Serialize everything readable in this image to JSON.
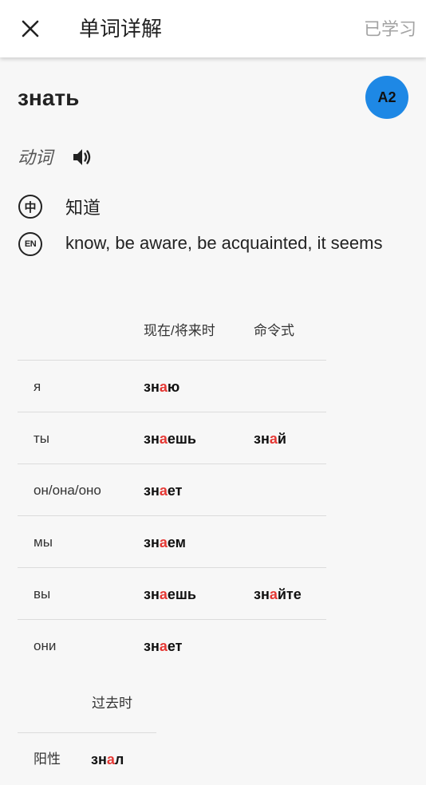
{
  "appbar": {
    "title": "单词详解",
    "learned_label": "已学习"
  },
  "word": {
    "text": "знать",
    "level": "A2",
    "part_of_speech": "动词",
    "meanings": {
      "zh_icon": "中",
      "zh": "知道",
      "en_icon": "EN",
      "en": "know, be aware, be acquainted, it seems"
    }
  },
  "conjugation": {
    "headers": {
      "present": "现在/将来时",
      "imperative": "命令式"
    },
    "rows": [
      {
        "pronoun": "я",
        "present": {
          "pre": "зн",
          "hl": "а",
          "post": "ю"
        },
        "imperative": null
      },
      {
        "pronoun": "ты",
        "present": {
          "pre": "зн",
          "hl": "а",
          "post": "ешь"
        },
        "imperative": {
          "pre": "зн",
          "hl": "а",
          "post": "й"
        }
      },
      {
        "pronoun": "он/она/оно",
        "present": {
          "pre": "зн",
          "hl": "а",
          "post": "ет"
        },
        "imperative": null
      },
      {
        "pronoun": "мы",
        "present": {
          "pre": "зн",
          "hl": "а",
          "post": "ем"
        },
        "imperative": null
      },
      {
        "pronoun": "вы",
        "present": {
          "pre": "зн",
          "hl": "а",
          "post": "ешь"
        },
        "imperative": {
          "pre": "зн",
          "hl": "а",
          "post": "йте"
        }
      },
      {
        "pronoun": "они",
        "present": {
          "pre": "зн",
          "hl": "а",
          "post": "ет"
        },
        "imperative": null
      }
    ]
  },
  "past": {
    "header": "过去时",
    "rows": [
      {
        "pronoun": "阳性",
        "form": {
          "pre": "зн",
          "hl": "а",
          "post": "л"
        }
      }
    ]
  },
  "colors": {
    "accent": "#1e88e5",
    "highlight": "#e53935"
  },
  "icons": {
    "close": "close-icon",
    "speaker": "speaker-icon",
    "zh": "chinese-language-icon",
    "en": "english-language-icon"
  }
}
